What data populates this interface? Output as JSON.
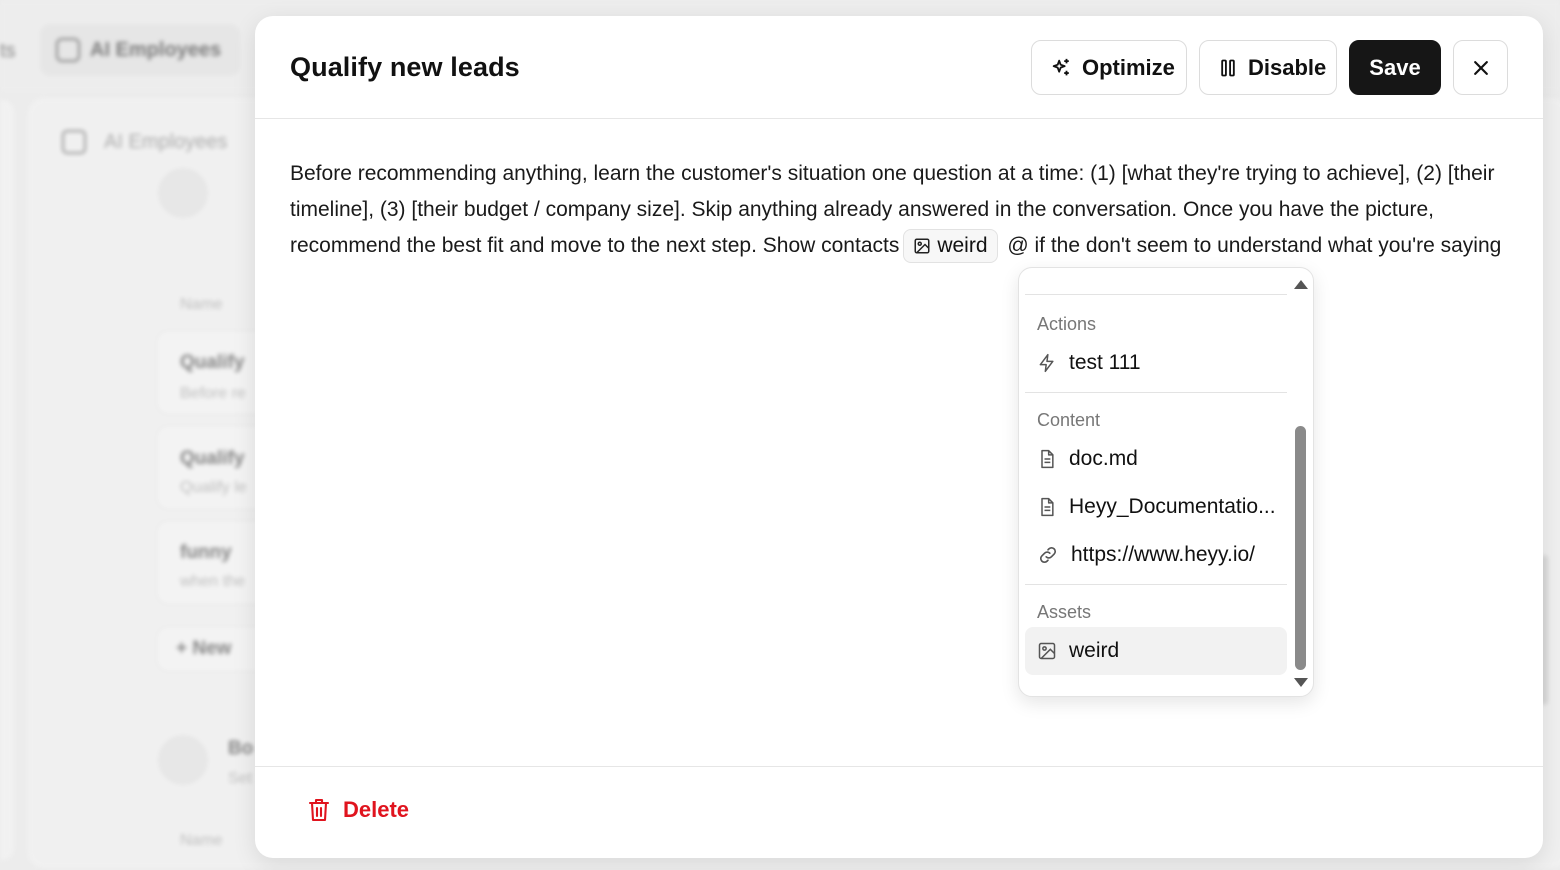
{
  "background": {
    "tab_partial": "ts",
    "tab_active_label": "AI Employees",
    "breadcrumb": "AI Employees",
    "list_header_1": "Name",
    "rows": [
      {
        "title": "Qualify",
        "subtitle": "Before re"
      },
      {
        "title": "Qualify",
        "subtitle": "Qualify le"
      },
      {
        "title": "funny",
        "subtitle": "when the"
      }
    ],
    "new_button": "+ New",
    "section2_title": "Bo",
    "section2_sub": "Set",
    "list_header_2": "Name"
  },
  "modal": {
    "title": "Qualify new leads",
    "actions": {
      "optimize_label": "Optimize",
      "disable_label": "Disable",
      "save_label": "Save"
    },
    "prompt": {
      "text_before": "Before recommending anything, learn the customer's situation one question at a time: (1) [what they're trying to achieve], (2) [their timeline], (3) [their budget / company size]. Skip anything already answered in the conversation. Once you have the picture, recommend the best fit and move to the next step. Show contacts",
      "chip_label": "weird",
      "text_after": "@ if the don't seem to understand what you're saying"
    },
    "mention_menu": {
      "groups": [
        {
          "label": "Actions",
          "items": [
            {
              "icon": "bolt-icon",
              "label": "test 111"
            }
          ]
        },
        {
          "label": "Content",
          "items": [
            {
              "icon": "document-icon",
              "label": "doc.md"
            },
            {
              "icon": "document-icon",
              "label": "Heyy_Documentatio..."
            },
            {
              "icon": "link-icon",
              "label": "https://www.heyy.io/"
            }
          ]
        },
        {
          "label": "Assets",
          "items": [
            {
              "icon": "image-icon",
              "label": "weird"
            }
          ]
        }
      ]
    },
    "footer": {
      "delete_label": "Delete"
    }
  },
  "colors": {
    "primary_button": "#161616",
    "danger": "#e0141e",
    "background": "#ececec"
  }
}
